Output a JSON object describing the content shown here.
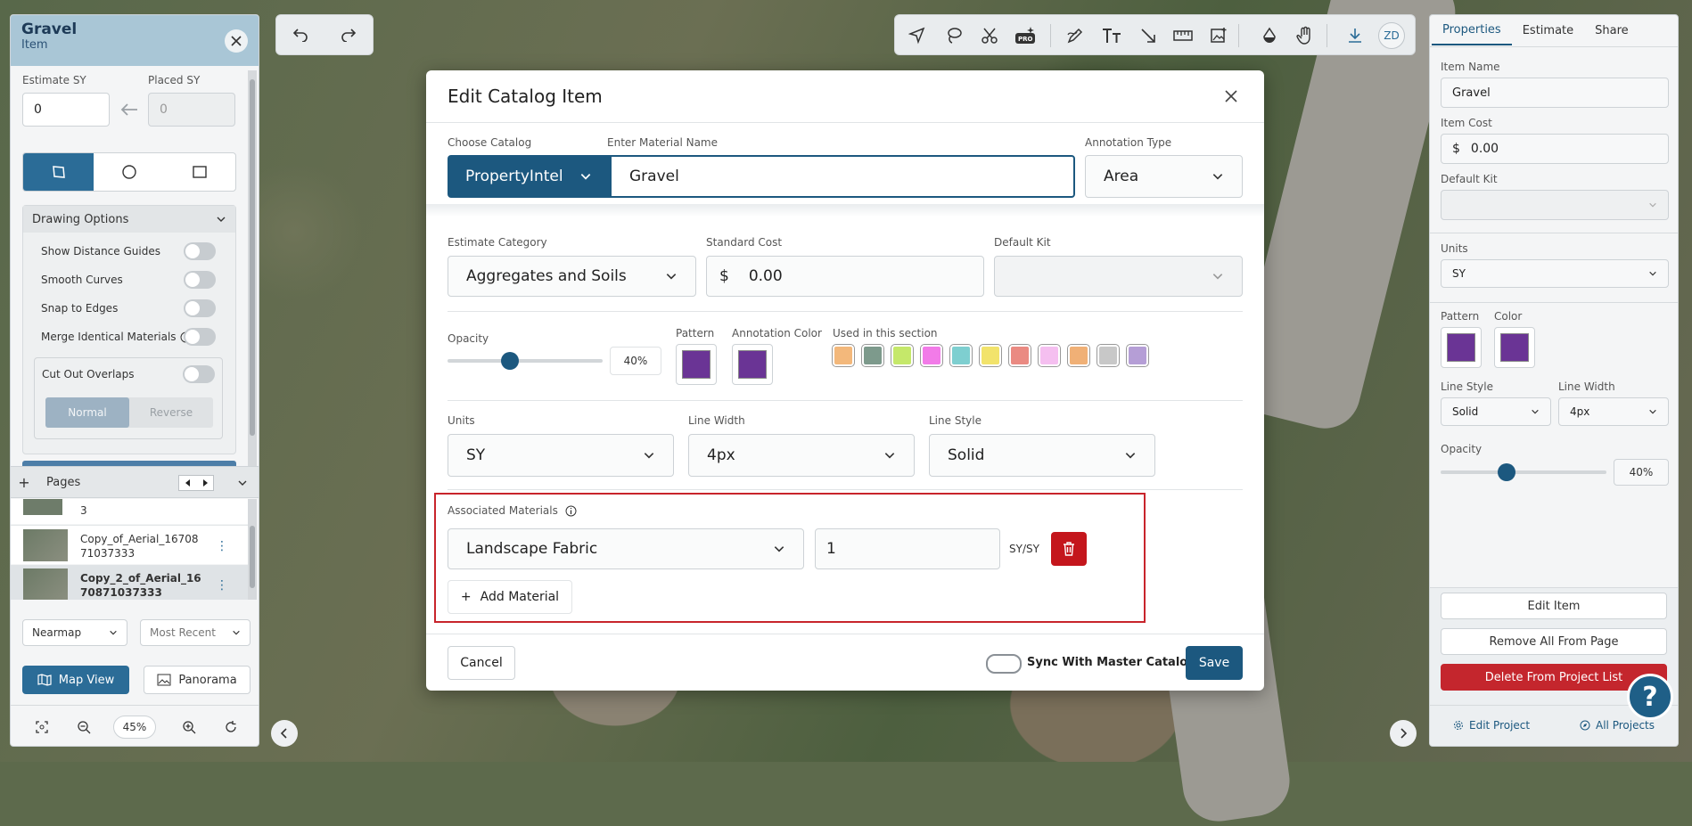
{
  "left_panel": {
    "title": "Gravel",
    "subtitle": "Item",
    "estimate_sy_label": "Estimate SY",
    "estimate_sy_value": "0",
    "placed_sy_label": "Placed SY",
    "placed_sy_value": "0",
    "drawing_options_label": "Drawing Options",
    "options": [
      {
        "label": "Show Distance Guides"
      },
      {
        "label": "Smooth Curves"
      },
      {
        "label": "Snap to Edges"
      },
      {
        "label": "Merge Identical Materials"
      }
    ],
    "cut_out_overlaps_label": "Cut Out Overlaps",
    "normal_label": "Normal",
    "reverse_label": "Reverse",
    "pages_label": "Pages",
    "pages": [
      {
        "name_partial": "3"
      },
      {
        "name": "Copy_of_Aerial_16708 71037333"
      },
      {
        "name": "Copy_2_of_Aerial_16 70871037333"
      }
    ],
    "source_select": "Nearmap",
    "date_select": "Most Recent",
    "map_view_label": "Map View",
    "panorama_label": "Panorama",
    "zoom_value": "45%"
  },
  "top_toolbar": {
    "user_initials": "ZD",
    "pro_badge": "PRO"
  },
  "modal": {
    "title": "Edit Catalog Item",
    "choose_catalog_label": "Choose Catalog",
    "catalog_value": "PropertyIntel",
    "material_name_label": "Enter Material Name",
    "material_name_value": "Gravel",
    "annotation_type_label": "Annotation Type",
    "annotation_type_value": "Area",
    "estimate_category_label": "Estimate Category",
    "estimate_category_value": "Aggregates and Soils",
    "standard_cost_label": "Standard Cost",
    "currency_symbol": "$",
    "standard_cost_value": "0.00",
    "default_kit_label": "Default Kit",
    "opacity_label": "Opacity",
    "opacity_value": "40%",
    "opacity_fraction": 0.4,
    "pattern_label": "Pattern",
    "annotation_color_label": "Annotation Color",
    "used_in_section_label": "Used in this section",
    "used_colors": [
      "#f3b87b",
      "#7d9a8c",
      "#c5e86a",
      "#f27be8",
      "#7ecfd0",
      "#f2e36b",
      "#ea8a82",
      "#f5bff0",
      "#f0b076",
      "#c8c8c8",
      "#b59ed6"
    ],
    "annotation_color": "#6a3495",
    "units_label": "Units",
    "units_value": "SY",
    "line_width_label": "Line Width",
    "line_width_value": "4px",
    "line_style_label": "Line Style",
    "line_style_value": "Solid",
    "associated_materials_label": "Associated Materials",
    "associated_material_value": "Landscape Fabric",
    "associated_qty_value": "1",
    "associated_unit": "SY/SY",
    "add_material_label": "Add Material",
    "cancel_label": "Cancel",
    "sync_label": "Sync With Master Catalog",
    "save_label": "Save"
  },
  "right_panel": {
    "tabs": [
      "Properties",
      "Estimate",
      "Share"
    ],
    "item_name_label": "Item Name",
    "item_name_value": "Gravel",
    "item_cost_label": "Item Cost",
    "currency_symbol": "$",
    "item_cost_value": "0.00",
    "default_kit_label": "Default Kit",
    "units_label": "Units",
    "units_value": "SY",
    "pattern_label": "Pattern",
    "color_label": "Color",
    "line_style_label": "Line Style",
    "line_style_value": "Solid",
    "line_width_label": "Line Width",
    "line_width_value": "4px",
    "opacity_label": "Opacity",
    "opacity_value": "40%",
    "edit_item_label": "Edit Item",
    "remove_all_label": "Remove All From Page",
    "delete_label": "Delete From Project List",
    "edit_project_label": "Edit Project",
    "all_projects_label": "All Projects",
    "help_label": "?"
  }
}
